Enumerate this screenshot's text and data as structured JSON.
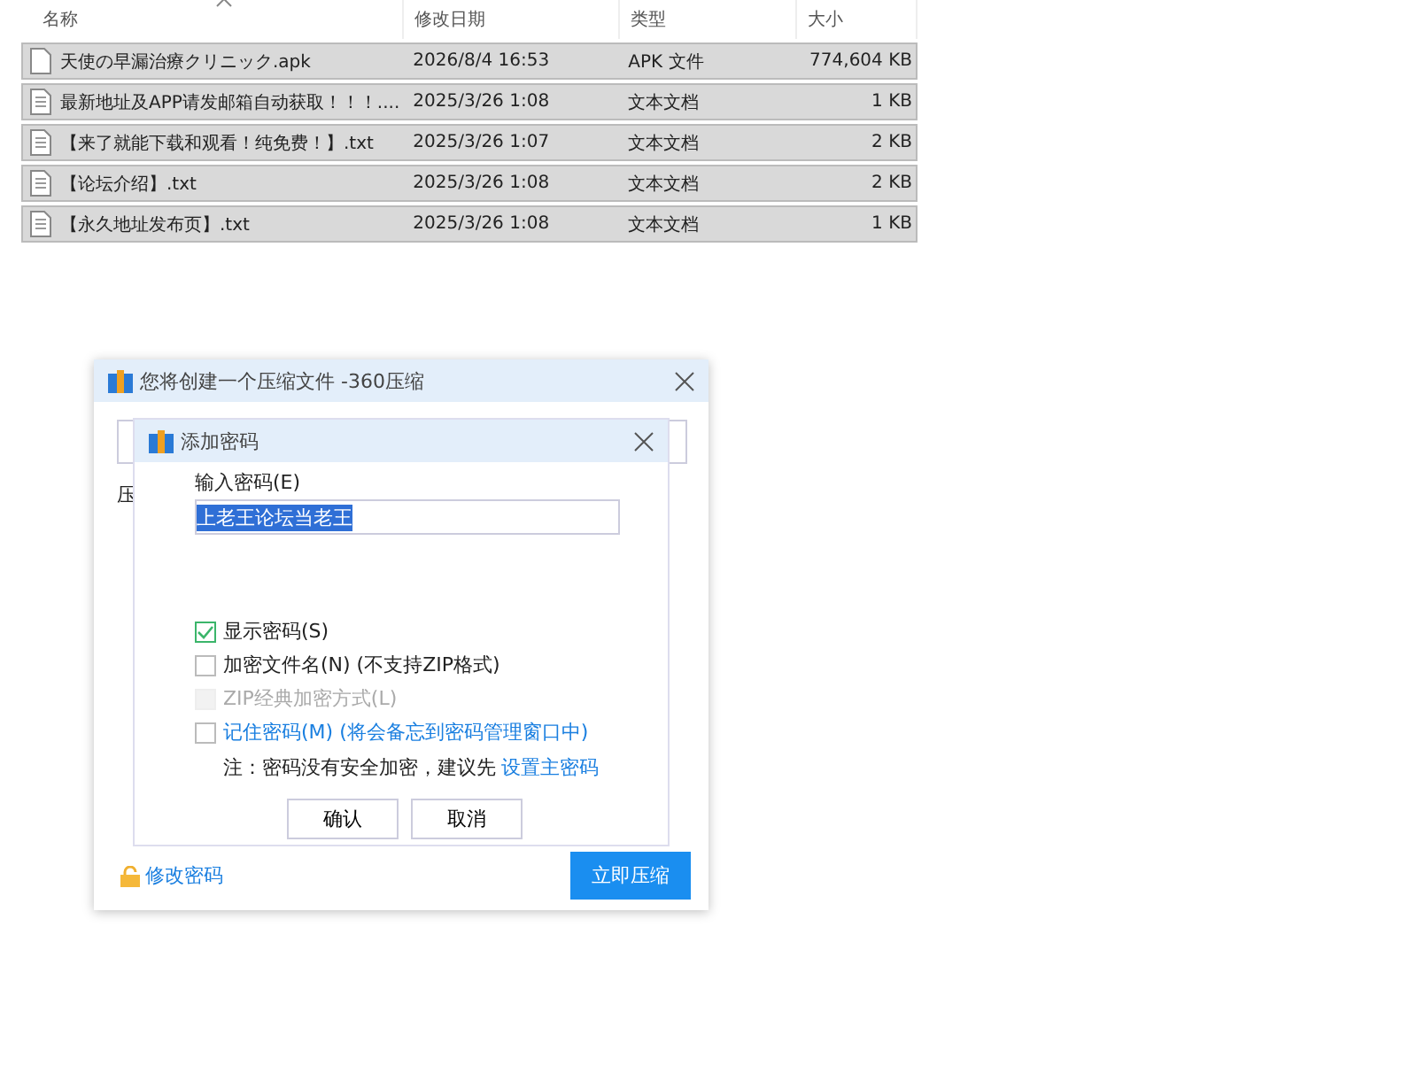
{
  "file_list": {
    "columns": [
      {
        "label": "名称",
        "sorted": true
      },
      {
        "label": "修改日期",
        "sorted": false
      },
      {
        "label": "类型",
        "sorted": false
      },
      {
        "label": "大小",
        "sorted": false
      }
    ],
    "rows": [
      {
        "kind": "apk",
        "name": "天使の早漏治療クリニック.apk",
        "date": "2026/8/4 16:53",
        "type": "APK 文件",
        "size": "774,604 KB",
        "selected": true
      },
      {
        "kind": "txt",
        "name": "最新地址及APP请发邮箱自动获取！！！....",
        "date": "2025/3/26 1:08",
        "type": "文本文档",
        "size": "1 KB",
        "selected": true
      },
      {
        "kind": "txt",
        "name": "【来了就能下载和观看！纯免费！】.txt",
        "date": "2025/3/26 1:07",
        "type": "文本文档",
        "size": "2 KB",
        "selected": true
      },
      {
        "kind": "txt",
        "name": "【论坛介绍】.txt",
        "date": "2025/3/26 1:08",
        "type": "文本文档",
        "size": "2 KB",
        "selected": true
      },
      {
        "kind": "txt",
        "name": "【永久地址发布页】.txt",
        "date": "2025/3/26 1:08",
        "type": "文本文档",
        "size": "1 KB",
        "selected": true
      }
    ]
  },
  "archive_dialog": {
    "title": "您将创建一个压缩文件 -360压缩",
    "label_fragment": "压",
    "change_password_link": "修改密码",
    "compress_button": "立即压缩"
  },
  "password_dialog": {
    "title": "添加密码",
    "password_label": "输入密码(E)",
    "password_value": "上老王论坛当老王",
    "password_selected": true,
    "options": [
      {
        "label": "显示密码(S)",
        "checked": true,
        "disabled": false,
        "link": false
      },
      {
        "label": "加密文件名(N) (不支持ZIP格式)",
        "checked": false,
        "disabled": false,
        "link": false
      },
      {
        "label": "ZIP经典加密方式(L)",
        "checked": false,
        "disabled": true,
        "link": false
      },
      {
        "label": "记住密码(M) (将会备忘到密码管理窗口中)",
        "checked": false,
        "disabled": false,
        "link": true
      }
    ],
    "note": "注：密码没有安全加密，建议先",
    "note_link": "设置主密码",
    "buttons": [
      "确认",
      "取消"
    ]
  }
}
